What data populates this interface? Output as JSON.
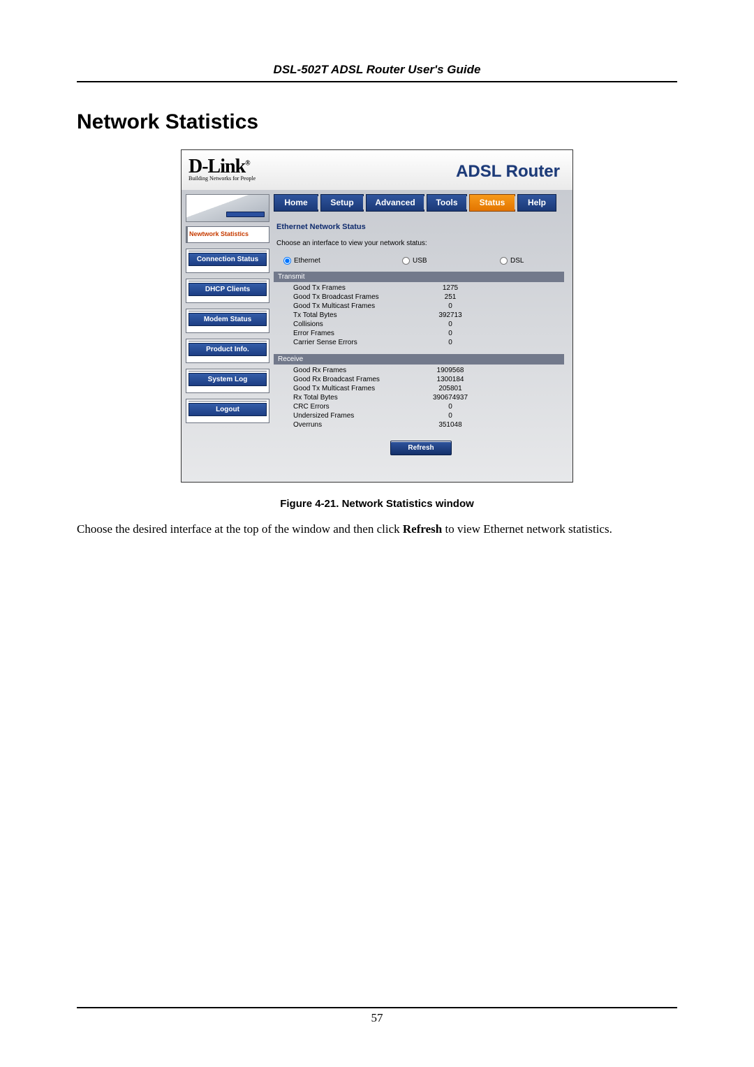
{
  "doc": {
    "header": "DSL-502T ADSL Router User's Guide",
    "section_title": "Network Statistics",
    "figure_caption": "Figure 4-21. Network Statistics window",
    "body_pre": "Choose the desired interface at the top of the window and then click ",
    "body_bold": "Refresh",
    "body_post": " to view Ethernet network statistics.",
    "page_number": "57"
  },
  "brand": {
    "name": "D-Link",
    "tag": "Building Networks for People"
  },
  "router_title": "ADSL Router",
  "tabs": {
    "home": "Home",
    "setup": "Setup",
    "advanced": "Advanced",
    "tools": "Tools",
    "status": "Status",
    "help": "Help"
  },
  "sidebar": {
    "current": "Newtwork Statistics",
    "items": [
      "Connection Status",
      "DHCP Clients",
      "Modem Status",
      "Product Info.",
      "System Log",
      "Logout"
    ]
  },
  "panel": {
    "title": "Ethernet Network Status",
    "desc": "Choose an interface to view your network status:",
    "radios": {
      "ethernet": "Ethernet",
      "usb": "USB",
      "dsl": "DSL"
    },
    "tx_header": "Transmit",
    "rx_header": "Receive",
    "refresh": "Refresh",
    "tx": [
      {
        "k": "Good Tx Frames",
        "v": "1275"
      },
      {
        "k": "Good Tx Broadcast Frames",
        "v": "251"
      },
      {
        "k": "Good Tx Multicast Frames",
        "v": "0"
      },
      {
        "k": "Tx Total Bytes",
        "v": "392713"
      },
      {
        "k": "Collisions",
        "v": "0"
      },
      {
        "k": "Error Frames",
        "v": "0"
      },
      {
        "k": "Carrier Sense Errors",
        "v": "0"
      }
    ],
    "rx": [
      {
        "k": "Good Rx Frames",
        "v": "1909568"
      },
      {
        "k": "Good Rx Broadcast Frames",
        "v": "1300184"
      },
      {
        "k": "Good Tx Multicast Frames",
        "v": "205801"
      },
      {
        "k": "Rx Total Bytes",
        "v": "390674937"
      },
      {
        "k": "CRC Errors",
        "v": "0"
      },
      {
        "k": "Undersized Frames",
        "v": "0"
      },
      {
        "k": "Overruns",
        "v": "351048"
      }
    ]
  }
}
